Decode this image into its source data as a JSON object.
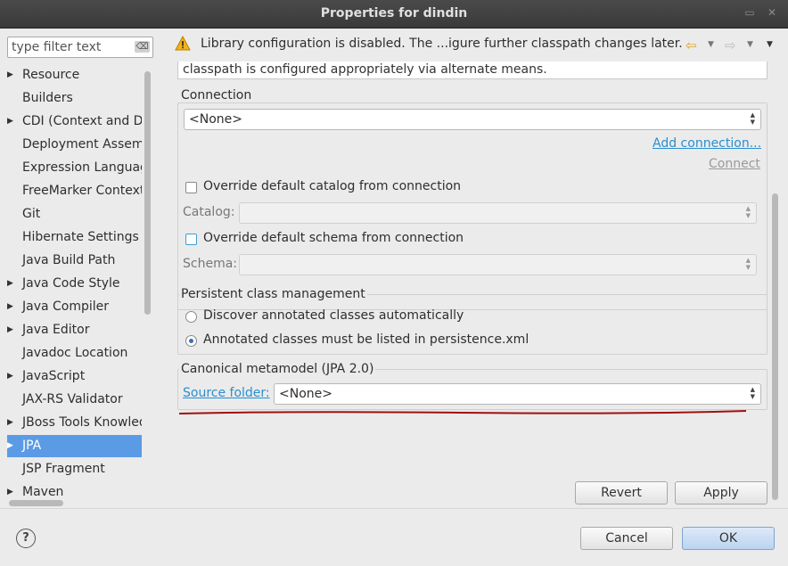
{
  "window": {
    "title": "Properties for dindin",
    "buttons": [
      "minimize-icon",
      "maximize-icon",
      "close-icon"
    ]
  },
  "filter": {
    "placeholder": "type filter text"
  },
  "tree": {
    "items": [
      {
        "label": "Resource",
        "expandable": true
      },
      {
        "label": "Builders",
        "expandable": false
      },
      {
        "label": "CDI (Context and De",
        "expandable": true
      },
      {
        "label": "Deployment Assemb",
        "expandable": false
      },
      {
        "label": "Expression Languag",
        "expandable": false
      },
      {
        "label": "FreeMarker Context",
        "expandable": false
      },
      {
        "label": "Git",
        "expandable": false
      },
      {
        "label": "Hibernate Settings",
        "expandable": false
      },
      {
        "label": "Java Build Path",
        "expandable": false
      },
      {
        "label": "Java Code Style",
        "expandable": true
      },
      {
        "label": "Java Compiler",
        "expandable": true
      },
      {
        "label": "Java Editor",
        "expandable": true
      },
      {
        "label": "Javadoc Location",
        "expandable": false
      },
      {
        "label": "JavaScript",
        "expandable": true
      },
      {
        "label": "JAX-RS Validator",
        "expandable": false
      },
      {
        "label": "JBoss Tools Knowled",
        "expandable": true
      },
      {
        "label": "JPA",
        "expandable": true,
        "selected": true
      },
      {
        "label": "JSP Fragment",
        "expandable": false
      },
      {
        "label": "Maven",
        "expandable": true
      }
    ]
  },
  "message": {
    "text": "Library configuration is disabled. The ...igure further classpath changes later.",
    "icon": "warning-icon"
  },
  "description": "classpath is configured appropriately via alternate means.",
  "connection": {
    "title": "Connection",
    "value": "<None>",
    "add_link": "Add connection...",
    "connect_link": "Connect",
    "override_catalog": "Override default catalog from connection",
    "catalog_label": "Catalog:",
    "override_schema": "Override default schema from connection",
    "schema_label": "Schema:"
  },
  "persistent": {
    "title": "Persistent class management",
    "discover": "Discover annotated classes automatically",
    "listed": "Annotated classes must be listed in persistence.xml",
    "selected": "listed"
  },
  "canonical": {
    "title": "Canonical metamodel (JPA 2.0)",
    "source_link": "Source folder:",
    "value": "<None>"
  },
  "actions": {
    "revert": "Revert",
    "apply": "Apply"
  },
  "dialog": {
    "cancel": "Cancel",
    "ok": "OK",
    "help_icon": "help-icon"
  },
  "colors": {
    "selection": "#5b9be5",
    "link": "#2a8fd0",
    "annotation": "#a01010"
  }
}
